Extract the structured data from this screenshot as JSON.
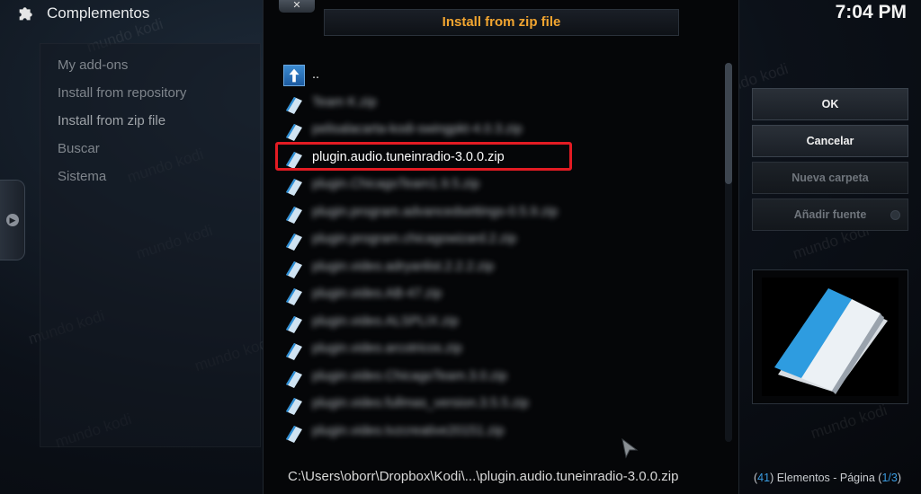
{
  "app": {
    "section_title": "Complementos",
    "clock": "7:04 PM"
  },
  "left_menu": {
    "items": [
      {
        "label": "My add-ons"
      },
      {
        "label": "Install from repository"
      },
      {
        "label": "Install from zip file"
      },
      {
        "label": "Buscar"
      },
      {
        "label": "Sistema"
      }
    ]
  },
  "dialog": {
    "close_label": "✕",
    "title": "Install from zip file",
    "up_label": "..",
    "files": [
      {
        "label": "Team K.zip",
        "blurred": true
      },
      {
        "label": "pelisalacarta-kodi-swingpkt-4.0.3.zip",
        "blurred": true
      },
      {
        "label": "plugin.audio.tuneinradio-3.0.0.zip",
        "blurred": false,
        "highlighted": true
      },
      {
        "label": "plugin.ChicagoTeam1.9.5.zip",
        "blurred": true
      },
      {
        "label": "plugin.program.advancedsettings-0.5.9.zip",
        "blurred": true
      },
      {
        "label": "plugin.program.chicagowizard.2.zip",
        "blurred": true
      },
      {
        "label": "plugin.video.adryanlist.2.2.2.zip",
        "blurred": true
      },
      {
        "label": "plugin.video.AB-47.zip",
        "blurred": true
      },
      {
        "label": "plugin.video.ALSPLIX.zip",
        "blurred": true
      },
      {
        "label": "plugin.video.arcotricos.zip",
        "blurred": true
      },
      {
        "label": "plugin.video.ChicagoTeam.3.0.zip",
        "blurred": true
      },
      {
        "label": "plugin.video.fullmas_version.3.5.5.zip",
        "blurred": true
      },
      {
        "label": "plugin.video.tvzcreative20151.zip",
        "blurred": true
      }
    ],
    "path": "C:\\Users\\oborr\\Dropbox\\Kodi\\...\\plugin.audio.tuneinradio-3.0.0.zip"
  },
  "right_panel": {
    "ok_label": "OK",
    "cancel_label": "Cancelar",
    "new_folder_label": "Nueva carpeta",
    "add_source_label": "Añadir fuente",
    "count_prefix": "(",
    "count_value": "41",
    "count_middle": ") Elementos - Página (",
    "page_value": "1/3",
    "count_suffix": ")"
  },
  "watermark": "mundo kodi",
  "colors": {
    "title_accent": "#f2a530",
    "highlight_border": "#e31b23",
    "count_accent": "#3a9be0"
  }
}
